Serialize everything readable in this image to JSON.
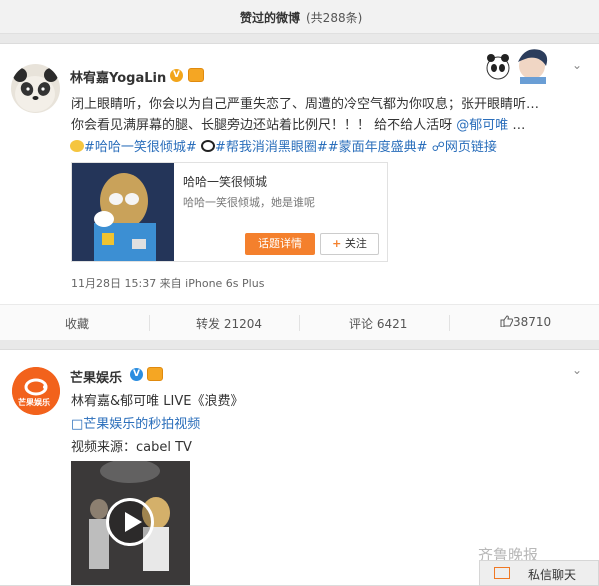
{
  "header": {
    "title": "赞过的微博",
    "count": "(共288条)"
  },
  "post1": {
    "author": "林宥嘉YogaLin",
    "line1": "闭上眼睛听，你会以为自己严重失恋了、周遭的冷空气都为你叹息；张开眼睛听…",
    "line2_prefix": "你会看见满屏幕的腿、长腿旁边还站着比例尺！！！ 给不给人活呀 ",
    "mention": "@郁可唯",
    "line2_suffix": " …",
    "topic1": "#哈哈一笑很倾城#",
    "topic2": "#帮我消消黑眼圈#",
    "topic3": "#蒙面年度盛典#",
    "weblink": "网页链接",
    "embed": {
      "title": "哈哈一笑很倾城",
      "subtitle": "哈哈一笑很倾城，她是谁呢",
      "topic_button": "话题详情",
      "follow_button": "关注"
    },
    "meta": "11月28日 15:37 来自 iPhone 6s Plus",
    "actions": {
      "collect": "收藏",
      "repost": "转发 21204",
      "comment": "评论 6421",
      "like": "38710"
    }
  },
  "post2": {
    "author": "芒果娱乐",
    "logo_text": "芒果娱乐",
    "line1": "林宥嘉&郁可唯 LIVE《浪费》",
    "video_link": "芒果娱乐的秒拍视频",
    "source": "视频来源：cabel TV"
  },
  "watermark": "齐鲁晚报",
  "chat": {
    "label": "私信聊天"
  },
  "colors": {
    "link": "#2a6ebb",
    "orange": "#f4802d",
    "mango": "#f2621c"
  }
}
